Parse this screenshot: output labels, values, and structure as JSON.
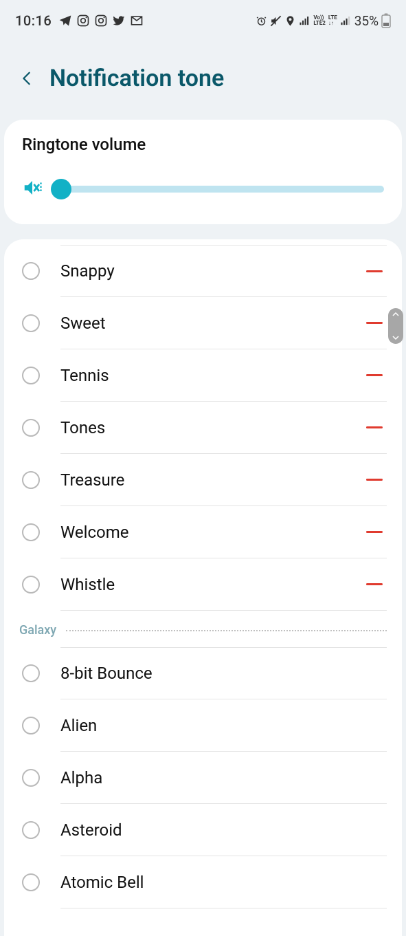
{
  "status": {
    "time": "10:16",
    "battery": "35%",
    "lte_top": "LTE",
    "lte_bot": "LTE2",
    "vo": "Vo))"
  },
  "header": {
    "title": "Notification tone"
  },
  "volume_card": {
    "title": "Ringtone volume",
    "slider_value_pct": 3
  },
  "sections": [
    {
      "name": null,
      "items": [
        {
          "label": "Snappy",
          "removable": true
        },
        {
          "label": "Sweet",
          "removable": true
        },
        {
          "label": "Tennis",
          "removable": true
        },
        {
          "label": "Tones",
          "removable": true
        },
        {
          "label": "Treasure",
          "removable": true
        },
        {
          "label": "Welcome",
          "removable": true
        },
        {
          "label": "Whistle",
          "removable": true
        }
      ]
    },
    {
      "name": "Galaxy",
      "items": [
        {
          "label": "8-bit Bounce",
          "removable": false
        },
        {
          "label": "Alien",
          "removable": false
        },
        {
          "label": "Alpha",
          "removable": false
        },
        {
          "label": "Asteroid",
          "removable": false
        },
        {
          "label": "Atomic Bell",
          "removable": false
        }
      ]
    }
  ]
}
